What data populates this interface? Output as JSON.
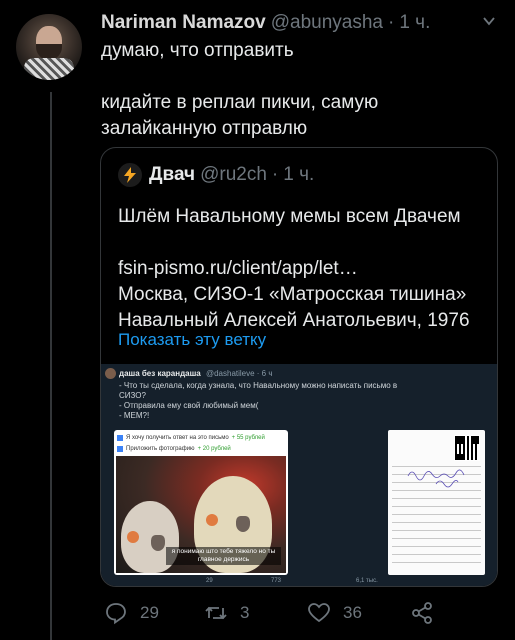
{
  "tweet": {
    "name": "Nariman Namazov",
    "handle": "@abunyasha",
    "separator": "·",
    "time": "1 ч.",
    "text": "думаю, что отправить\n\nкидайте в реплаи пикчи, самую залайканную отправлю"
  },
  "quote": {
    "name": "Двач",
    "handle": "@ru2ch",
    "separator": "·",
    "time": "1 ч.",
    "line1": "Шлём Навальному мемы всем Двачем",
    "line2": "fsin-pismo.ru/client/app/let…",
    "line3": "Москва, СИЗО-1 «Матросская тишина»",
    "line4": "Навальный Алексей Анатольевич, 1976",
    "show_thread": "Показать эту ветку"
  },
  "media": {
    "name": "даша без карандаша",
    "handle": "@dashatileve · 6 ч",
    "line1": "- Что ты сделала, когда узнала, что Навальному можно написать письмо в СИЗО?",
    "line2": "- Отправила ему свой любимый мем(",
    "line3": "- МЕМ?!",
    "check1": "Я хочу получить ответ на это письмо",
    "check1_price": "+ 55 рублей",
    "check2": "Приложить фотографию",
    "check2_price": "+ 20 рублей",
    "caption": "я понимаю што тебе тяжело но ты главное держись",
    "replies": "29",
    "retweets": "773",
    "likes": "6,1 тыс."
  },
  "actions": {
    "replies": "29",
    "retweets": "3",
    "likes": "36"
  },
  "colors": {
    "background": "#000000",
    "link": "#1d9bf0",
    "muted": "#6e767d"
  }
}
